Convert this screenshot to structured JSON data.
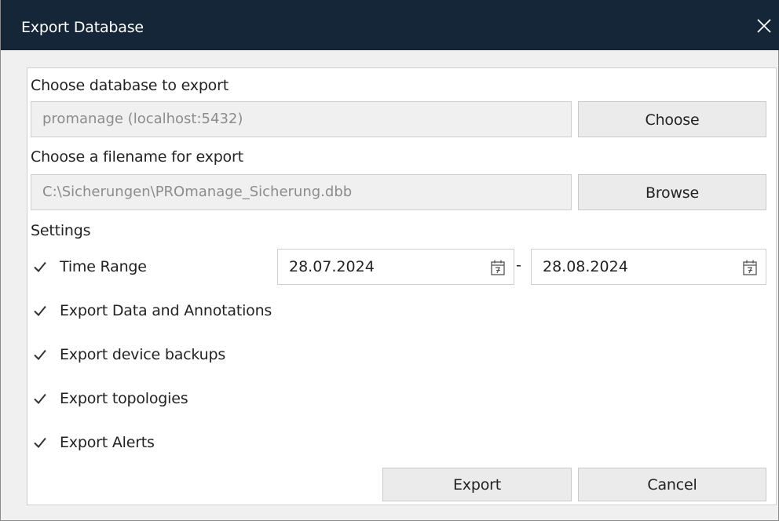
{
  "window": {
    "title": "Export Database"
  },
  "database": {
    "label": "Choose database to export",
    "value": "promanage (localhost:5432)",
    "choose_button": "Choose"
  },
  "filename": {
    "label": "Choose a filename for export",
    "value": "C:\\Sicherungen\\PROmanage_Sicherung.dbb",
    "browse_button": "Browse"
  },
  "settings": {
    "label": "Settings",
    "time_range": {
      "label": "Time Range",
      "checked": true,
      "from": "28.07.2024",
      "separator": "-",
      "to": "28.08.2024"
    },
    "options": [
      {
        "label": "Export Data and Annotations",
        "checked": true
      },
      {
        "label": "Export device backups",
        "checked": true
      },
      {
        "label": "Export topologies",
        "checked": true
      },
      {
        "label": "Export Alerts",
        "checked": true
      }
    ]
  },
  "footer": {
    "export_button": "Export",
    "cancel_button": "Cancel"
  },
  "icons": {
    "close": "close-icon",
    "calendar": "calendar-icon",
    "check": "checkmark-icon"
  },
  "colors": {
    "titlebar": "#152638",
    "panel_bg": "#ffffff",
    "window_bg": "#f0f0f0",
    "button_bg": "#ebebeb"
  }
}
